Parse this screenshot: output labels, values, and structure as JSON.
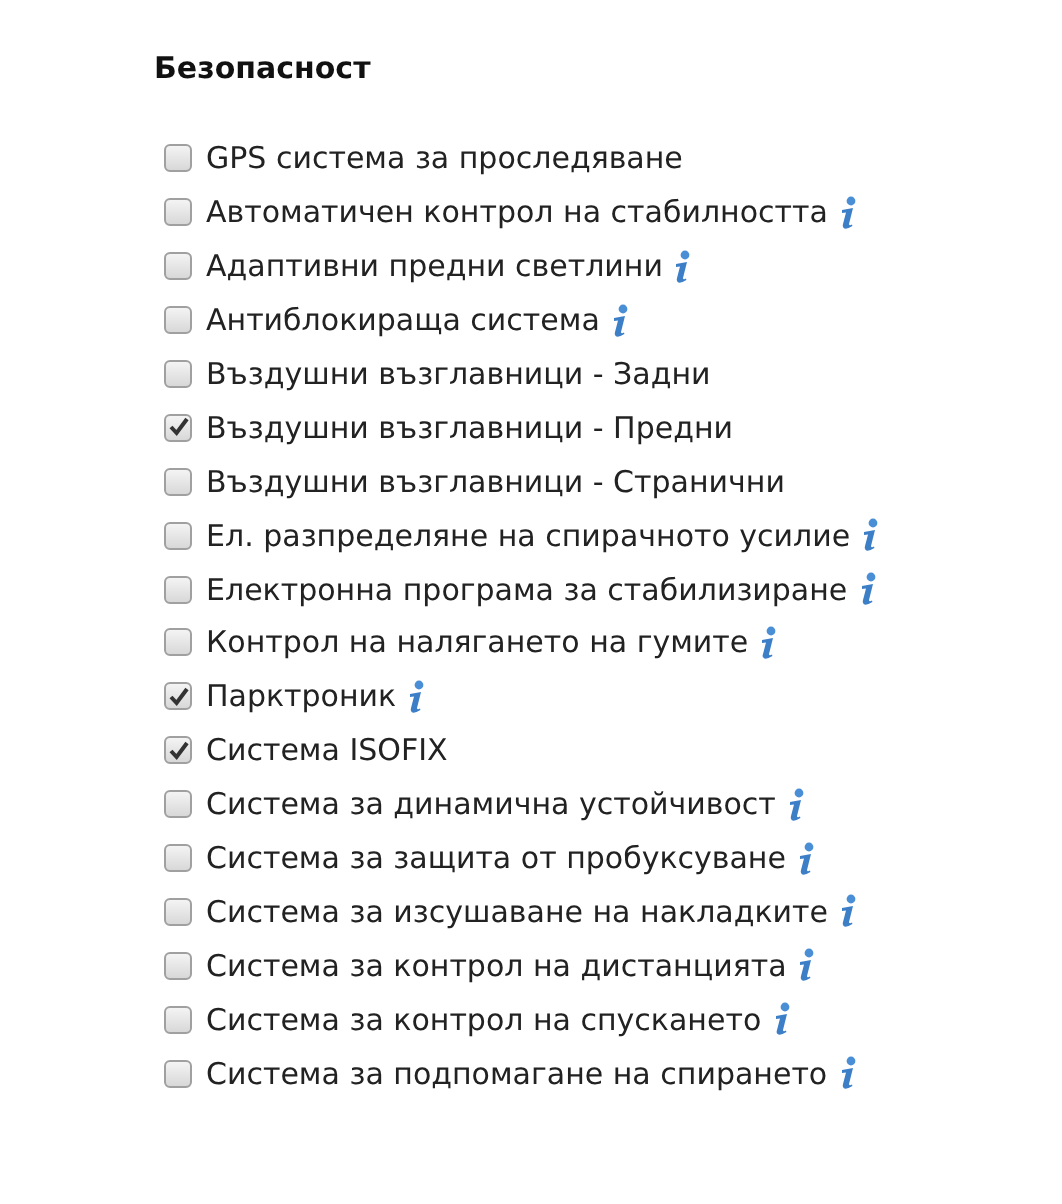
{
  "section": {
    "title": "Безопасност",
    "items": [
      {
        "label": "GPS система за проследяване",
        "checked": false,
        "info": false
      },
      {
        "label": "Автоматичен контрол на стабилността",
        "checked": false,
        "info": true
      },
      {
        "label": "Адаптивни предни светлини",
        "checked": false,
        "info": true
      },
      {
        "label": "Антиблокираща система",
        "checked": false,
        "info": true
      },
      {
        "label": "Въздушни възглавници - Задни",
        "checked": false,
        "info": false
      },
      {
        "label": "Въздушни възглавници - Предни",
        "checked": true,
        "info": false
      },
      {
        "label": "Въздушни възглавници - Странични",
        "checked": false,
        "info": false
      },
      {
        "label": "Ел. разпределяне на спирачното усилие",
        "checked": false,
        "info": true
      },
      {
        "label": "Електронна програма за стабилизиране",
        "checked": false,
        "info": true
      },
      {
        "label": "Контрол на налягането на гумите",
        "checked": false,
        "info": true
      },
      {
        "label": "Парктроник",
        "checked": true,
        "info": true
      },
      {
        "label": "Система ISOFIX",
        "checked": true,
        "info": false
      },
      {
        "label": "Система за динамична устойчивост",
        "checked": false,
        "info": true
      },
      {
        "label": "Система за защита от пробуксуване",
        "checked": false,
        "info": true
      },
      {
        "label": "Система за изсушаване на накладките",
        "checked": false,
        "info": true
      },
      {
        "label": "Система за контрол на дистанцията",
        "checked": false,
        "info": true
      },
      {
        "label": "Система за контрол на спускането",
        "checked": false,
        "info": true
      },
      {
        "label": "Система за подпомагане на спирането",
        "checked": false,
        "info": true
      }
    ]
  }
}
